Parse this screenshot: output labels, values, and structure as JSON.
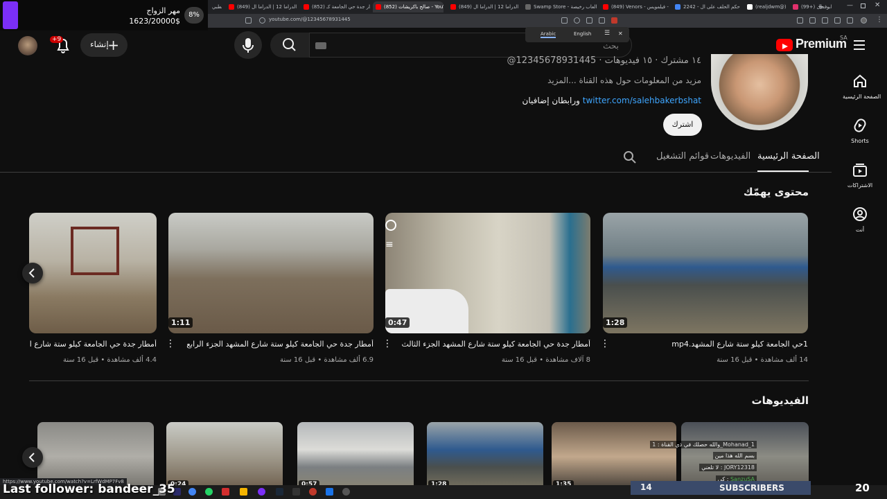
{
  "browser": {
    "tabs": [
      {
        "label": "التطبي"
      },
      {
        "label": "(849) انظار الدراما 12 | الدراما ال"
      },
      {
        "label": "(852) أمطار جدة حي الجامعة كـ"
      },
      {
        "label": "(852) صالح باكريشات - YouTube",
        "active": true
      },
      {
        "label": "(849) انظار الدراما 12 | الدراما ال"
      },
      {
        "label": "Swamp Store - العاب رخيصة"
      },
      {
        "label": "(849) Venors - فيلمويس - YouTube"
      },
      {
        "label": "2242 - حكم الحلف على ال"
      },
      {
        "label": "(realjdwm@)"
      },
      {
        "label": "(99+) علي ابوفضل"
      }
    ],
    "url": "youtube.com/@12345678931445"
  },
  "stream_goal": {
    "title": "مهر الزواج",
    "count": "1623/20000$",
    "percent": "8%"
  },
  "translate_popup": {
    "lang1": "Arabic",
    "lang2": "English"
  },
  "masthead": {
    "notifications_badge": "+9",
    "create_label": "إنشاء",
    "search_placeholder": "بحث",
    "logo_text": "Premium",
    "country_code": "SA"
  },
  "guide": [
    {
      "label": "الصفحة الرئيسية",
      "icon": "home-icon"
    },
    {
      "label": "Shorts",
      "icon": "shorts-icon"
    },
    {
      "label": "الاشتراكات",
      "icon": "subscriptions-icon"
    },
    {
      "label": "أنت",
      "icon": "you-icon"
    }
  ],
  "channel": {
    "handle_line": "@12345678931445 · ‏١٤ مشترك · ‏١٥ فيديوهات",
    "about": "مزيد من المعلومات حول هذه القناة ...المزيد",
    "links_prefix": "twitter.com/salehbakerbshat",
    "links_suffix": "ورابطان إضافيان",
    "subscribe_label": "اشترك"
  },
  "channel_tabs": [
    {
      "label": "الصفحة الرئيسية",
      "active": true
    },
    {
      "label": "الفيديوهات"
    },
    {
      "label": "قوائم التشغيل"
    }
  ],
  "shelf1": {
    "title": "محتوى يهمّك",
    "videos": [
      {
        "title": "1حي الجامعة كيلو ستة شارع المشهد.mp4",
        "meta": "14 ألف مشاهدة • قبل 16 سنة",
        "duration": "1:28"
      },
      {
        "title": "أمطار جدة حي الجامعة كيلو ستة شارع المشهد الجزء الثالث",
        "meta": "8 آلاف مشاهدة • قبل 16 سنة",
        "duration": "0:47"
      },
      {
        "title": "أمطار جدة حي الجامعة كيلو ستة شارع المشهد الجزء الرابع",
        "meta": "6.9 ألف مشاهدة • قبل 16 سنة",
        "duration": "1:11"
      },
      {
        "title": "أمطار جدة حي الجامعة كيلو ستة شارع المشهد ا",
        "meta": "4.4 ألف مشاهدة • قبل 16 سنة",
        "duration": ""
      }
    ]
  },
  "shelf2": {
    "title": "الفيديوهات",
    "durations": [
      "",
      "1:35",
      "1:28",
      "0:57",
      "0:24",
      ""
    ]
  },
  "stream_overlay": {
    "chat": [
      {
        "user": "1_Mohanad_1",
        "text": "والله حصلك في ذي القناة"
      },
      {
        "user": "",
        "text": "بسم الله هذا مين"
      },
      {
        "user": "JORY12318",
        "text": "لا تلعني"
      },
      {
        "user": "SanzuSA",
        "text": "كي"
      }
    ],
    "subs_number": "14",
    "subs_label": "SUBSCRIBERS",
    "last_follower": "Last follower: bandeer_35",
    "status_url": "https://www.youtube.com/watch?v=LrfWdMP7Fv8",
    "clock": "20"
  }
}
